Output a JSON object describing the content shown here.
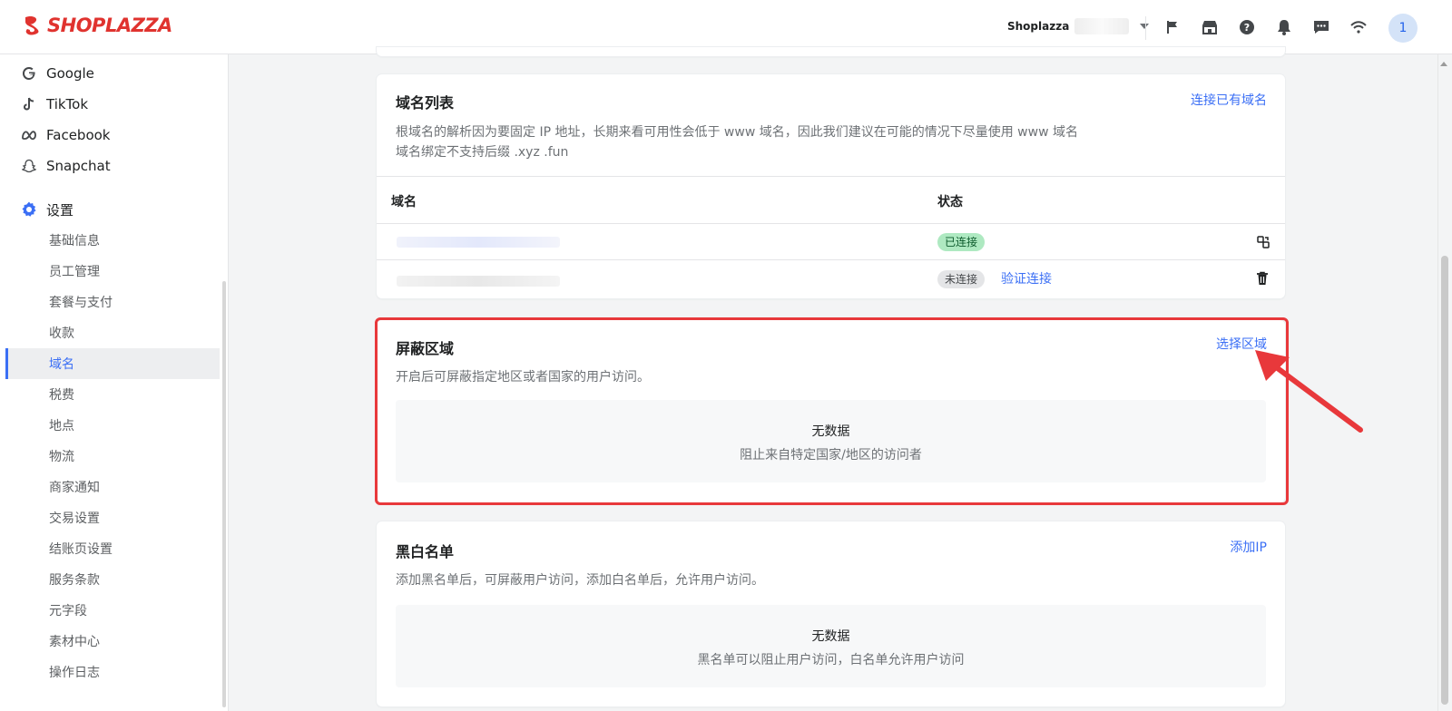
{
  "brand": {
    "name": "SHOPLAZZA",
    "color": "#e0332f"
  },
  "topbar": {
    "store_name": "Shoplazza",
    "icons": [
      "flag-icon",
      "store-icon",
      "help-icon",
      "bell-icon",
      "message-icon",
      "wifi-icon"
    ],
    "avatar_initial": "1"
  },
  "sidebar": {
    "channels": [
      {
        "label": "Google",
        "icon": "google-icon"
      },
      {
        "label": "TikTok",
        "icon": "tiktok-icon"
      },
      {
        "label": "Facebook",
        "icon": "meta-icon"
      },
      {
        "label": "Snapchat",
        "icon": "snapchat-icon"
      }
    ],
    "settings_label": "设置",
    "settings_items": [
      "基础信息",
      "员工管理",
      "套餐与支付",
      "收款",
      "域名",
      "税费",
      "地点",
      "物流",
      "商家通知",
      "交易设置",
      "结账页设置",
      "服务条款",
      "元字段",
      "素材中心",
      "操作日志"
    ],
    "active_item": "域名"
  },
  "domain_list": {
    "title": "域名列表",
    "action": "连接已有域名",
    "desc_line1": "根域名的解析因为要固定 IP 地址，长期来看可用性会低于 www 域名，因此我们建议在可能的情况下尽量使用 www 域名",
    "desc_line2": "域名绑定不支持后缀 .xyz .fun",
    "columns": {
      "domain": "域名",
      "status": "状态"
    },
    "rows": [
      {
        "status": "已连接",
        "action": "",
        "icon": "copy-link-icon"
      },
      {
        "status": "未连接",
        "action": "验证连接",
        "icon": "trash-icon"
      }
    ]
  },
  "blocked_regions": {
    "title": "屏蔽区域",
    "action": "选择区域",
    "desc": "开启后可屏蔽指定地区或者国家的用户访问。",
    "empty_title": "无数据",
    "empty_sub": "阻止来自特定国家/地区的访问者"
  },
  "blacklist": {
    "title": "黑白名单",
    "action": "添加IP",
    "desc": "添加黑名单后，可屏蔽用户访问，添加白名单后，允许用户访问。",
    "empty_title": "无数据",
    "empty_sub": "黑名单可以阻止用户访问，白名单允许用户访问"
  },
  "colors": {
    "link": "#3b6ff5",
    "highlight": "#e8383b",
    "success_badge": "#aee9c1"
  }
}
